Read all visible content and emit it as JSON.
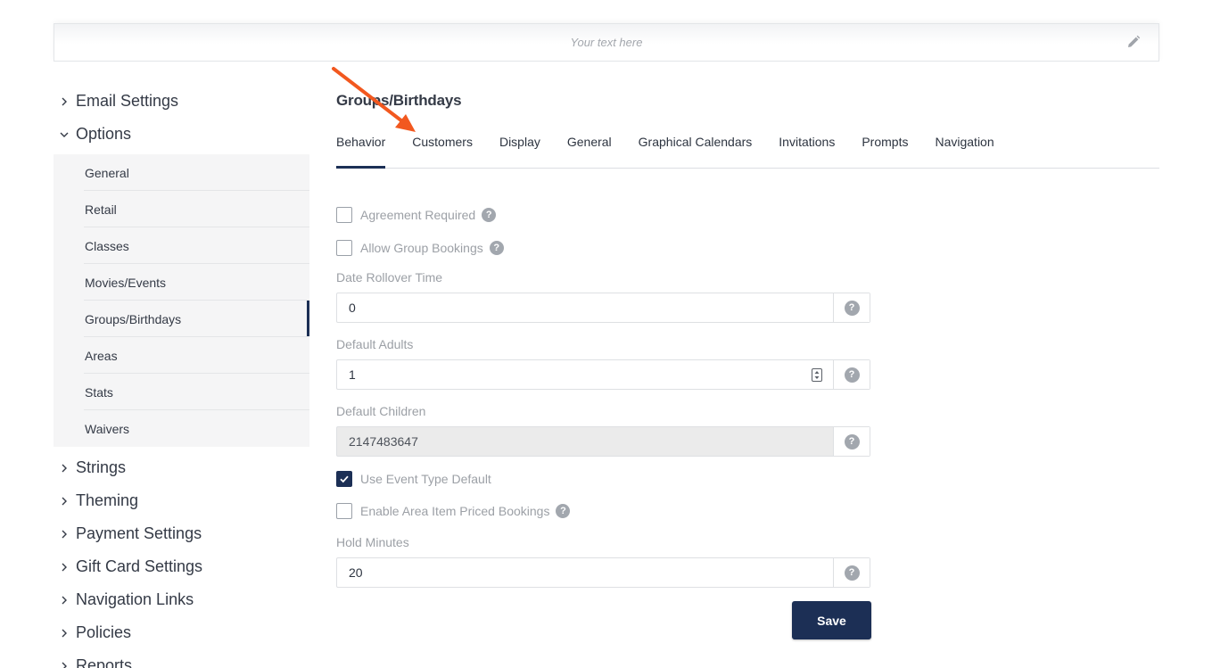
{
  "banner": {
    "placeholder": "Your text here",
    "edit_icon": "pencil-icon"
  },
  "sidebar": {
    "sections_top": [
      {
        "label": "Email Settings",
        "expanded": false
      },
      {
        "label": "Options",
        "expanded": true
      }
    ],
    "options_items": [
      {
        "label": "General"
      },
      {
        "label": "Retail"
      },
      {
        "label": "Classes"
      },
      {
        "label": "Movies/Events"
      },
      {
        "label": "Groups/Birthdays",
        "active": true
      },
      {
        "label": "Areas"
      },
      {
        "label": "Stats"
      },
      {
        "label": "Waivers"
      }
    ],
    "sections_bottom": [
      {
        "label": "Strings"
      },
      {
        "label": "Theming"
      },
      {
        "label": "Payment Settings"
      },
      {
        "label": "Gift Card Settings"
      },
      {
        "label": "Navigation Links"
      },
      {
        "label": "Policies"
      },
      {
        "label": "Reports"
      }
    ]
  },
  "main": {
    "title": "Groups/Birthdays",
    "tabs": [
      {
        "label": "Behavior",
        "active": true
      },
      {
        "label": "Customers"
      },
      {
        "label": "Display"
      },
      {
        "label": "General"
      },
      {
        "label": "Graphical Calendars"
      },
      {
        "label": "Invitations"
      },
      {
        "label": "Prompts"
      },
      {
        "label": "Navigation"
      }
    ],
    "form": {
      "agreement_required": {
        "label": "Agreement Required",
        "checked": false
      },
      "allow_group_bookings": {
        "label": "Allow Group Bookings",
        "checked": false
      },
      "date_rollover_time": {
        "label": "Date Rollover Time",
        "value": "0"
      },
      "default_adults": {
        "label": "Default Adults",
        "value": "1"
      },
      "default_children": {
        "label": "Default Children",
        "value": "2147483647",
        "disabled": true
      },
      "use_event_type_default": {
        "label": "Use Event Type Default",
        "checked": true
      },
      "enable_area_item_priced_bookings": {
        "label": "Enable Area Item Priced Bookings",
        "checked": false
      },
      "hold_minutes": {
        "label": "Hold Minutes",
        "value": "20"
      },
      "help_glyph": "?",
      "save_label": "Save"
    }
  },
  "colors": {
    "accent": "#1c2f55",
    "annotation_arrow": "#f2581f",
    "muted_text": "#9ca0a6"
  }
}
